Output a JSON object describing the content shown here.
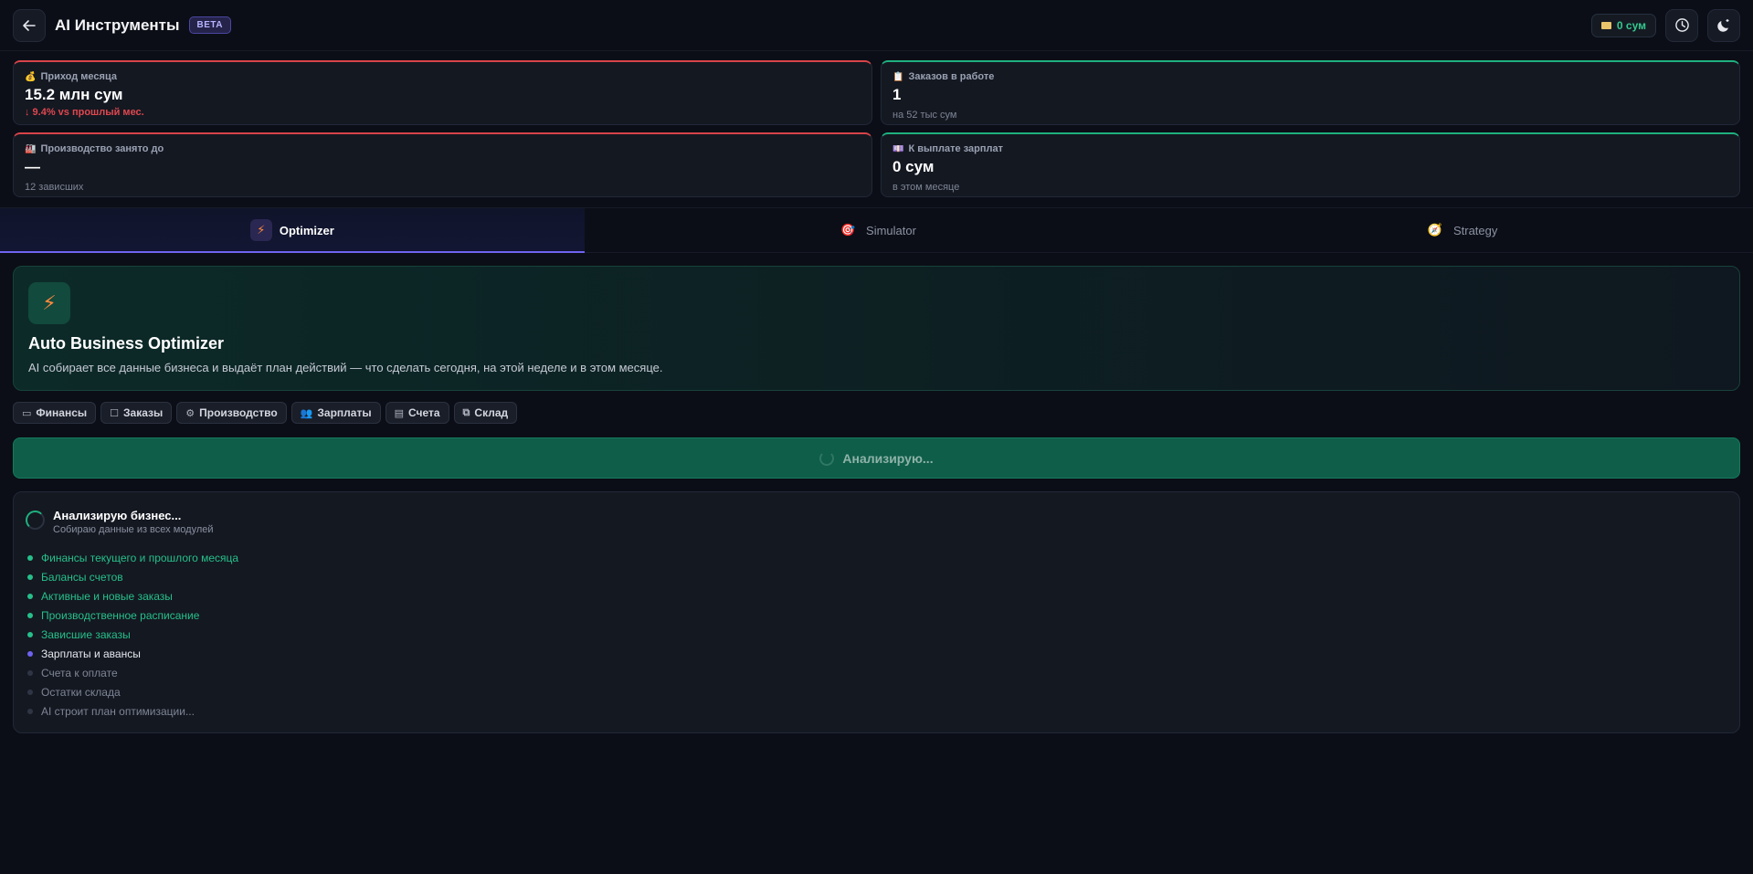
{
  "header": {
    "title": "AI Инструменты",
    "badge": "BETA",
    "balance": "0 сум"
  },
  "kpis": [
    {
      "label": "Приход месяца",
      "value": "15.2 млн сум",
      "sub": "↓ 9.4% vs прошлый мес."
    },
    {
      "label": "Заказов в работе",
      "value": "1",
      "sub": "на 52 тыс сум"
    },
    {
      "label": "Производство занято до",
      "value": "—",
      "sub": "12 зависших"
    },
    {
      "label": "К выплате зарплат",
      "value": "0 сум",
      "sub": "в этом месяце"
    }
  ],
  "tabs": [
    {
      "label": "Optimizer"
    },
    {
      "label": "Simulator"
    },
    {
      "label": "Strategy"
    }
  ],
  "hero": {
    "title": "Auto Business Optimizer",
    "description": "AI собирает все данные бизнеса и выдаёт план действий — что сделать сегодня, на этой неделе и в этом месяце."
  },
  "chips": [
    {
      "label": "Финансы"
    },
    {
      "label": "Заказы"
    },
    {
      "label": "Производство"
    },
    {
      "label": "Зарплаты"
    },
    {
      "label": "Счета"
    },
    {
      "label": "Склад"
    }
  ],
  "analyze_button": "Анализирую...",
  "progress": {
    "title": "Анализирую бизнес...",
    "subtitle": "Собираю данные из всех модулей",
    "steps": [
      {
        "label": "Финансы текущего и прошлого месяца"
      },
      {
        "label": "Балансы счетов"
      },
      {
        "label": "Активные и новые заказы"
      },
      {
        "label": "Производственное расписание"
      },
      {
        "label": "Зависшие заказы"
      },
      {
        "label": "Зарплаты и авансы"
      },
      {
        "label": "Счета к оплате"
      },
      {
        "label": "Остатки склада"
      },
      {
        "label": "AI строит план оптимизации..."
      }
    ]
  },
  "colors": {
    "accent": "#6f63f0",
    "success": "#26c08a",
    "danger": "#d9434a"
  }
}
